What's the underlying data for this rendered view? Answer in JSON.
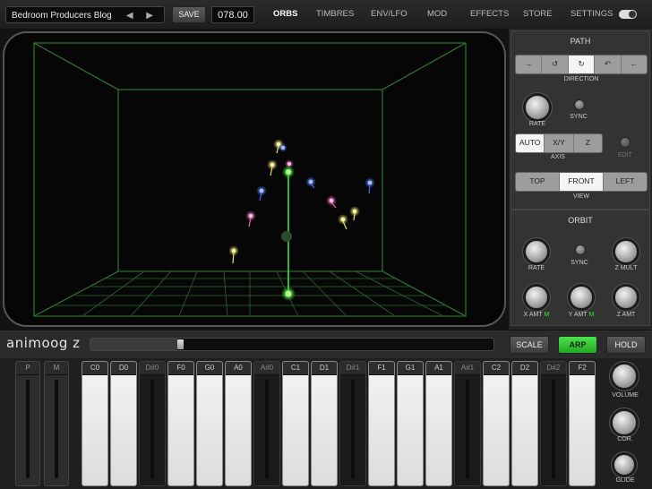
{
  "topbar": {
    "preset_name": "Bedroom Producers Blog",
    "preset_arrows": "◀ ▶",
    "save_label": "SAVE",
    "bpm_value": "078.00",
    "tabs": [
      "ORBS",
      "TIMBRES",
      "ENV/LFO",
      "MOD",
      "EFFECTS",
      "STORE",
      "SETTINGS"
    ],
    "active_tab": "ORBS"
  },
  "path": {
    "title": "PATH",
    "direction_label": "DIRECTION",
    "direction_icons": [
      "→",
      "↺",
      "↻",
      "↶",
      "←"
    ],
    "rate_label": "RATE",
    "sync_label": "SYNC",
    "axis_options": [
      "AUTO",
      "X/Y",
      "Z"
    ],
    "axis_selected": "AUTO",
    "axis_label": "AXIS",
    "edit_label": "EDIT",
    "view_options": [
      "TOP",
      "FRONT",
      "LEFT"
    ],
    "view_selected": "FRONT",
    "view_label": "VIEW"
  },
  "orbit": {
    "title": "ORBIT",
    "rate_label": "RATE",
    "sync_label": "SYNC",
    "zmult_label": "Z MULT",
    "xamt_label": "X AMT",
    "yamt_label": "Y AMT",
    "zamt_label": "Z AMT",
    "m_marker": "M"
  },
  "strip": {
    "logo": "animoog z",
    "slider_value_percent": 22,
    "scale_label": "SCALE",
    "arp_label": "ARP",
    "hold_label": "HOLD"
  },
  "keys": [
    "P",
    "M",
    "C0",
    "D0",
    "D#0",
    "F0",
    "G0",
    "A0",
    "A#0",
    "C1",
    "D1",
    "D#1",
    "F1",
    "G1",
    "A1",
    "A#1",
    "C2",
    "D2",
    "D#2",
    "F2"
  ],
  "right_knobs": {
    "volume_label": "VOLUME",
    "cor_label": "COR.",
    "glide_label": "GLIDE"
  },
  "colors": {
    "accent_green": "#3fe03f",
    "grid_green": "#2f7a2f",
    "orb_yellow": "#e8e060",
    "orb_blue": "#3b6cff",
    "orb_pink": "#ff5ab8"
  }
}
